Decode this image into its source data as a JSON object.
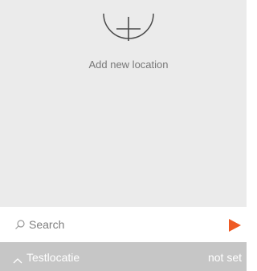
{
  "add_location": {
    "label": "Add new location",
    "icon": "plus-circle-icon"
  },
  "search": {
    "placeholder": "Search",
    "value": "",
    "icon": "search-icon",
    "submit_icon": "play-arrow-icon"
  },
  "footer": {
    "location_name": "Testlocatie",
    "status": "not set",
    "expand_icon": "chevron-up-icon"
  },
  "colors": {
    "map_background": "#ebebeb",
    "footer_background": "#c6c6c6",
    "accent": "#ee5a24",
    "text_muted": "#777777"
  }
}
